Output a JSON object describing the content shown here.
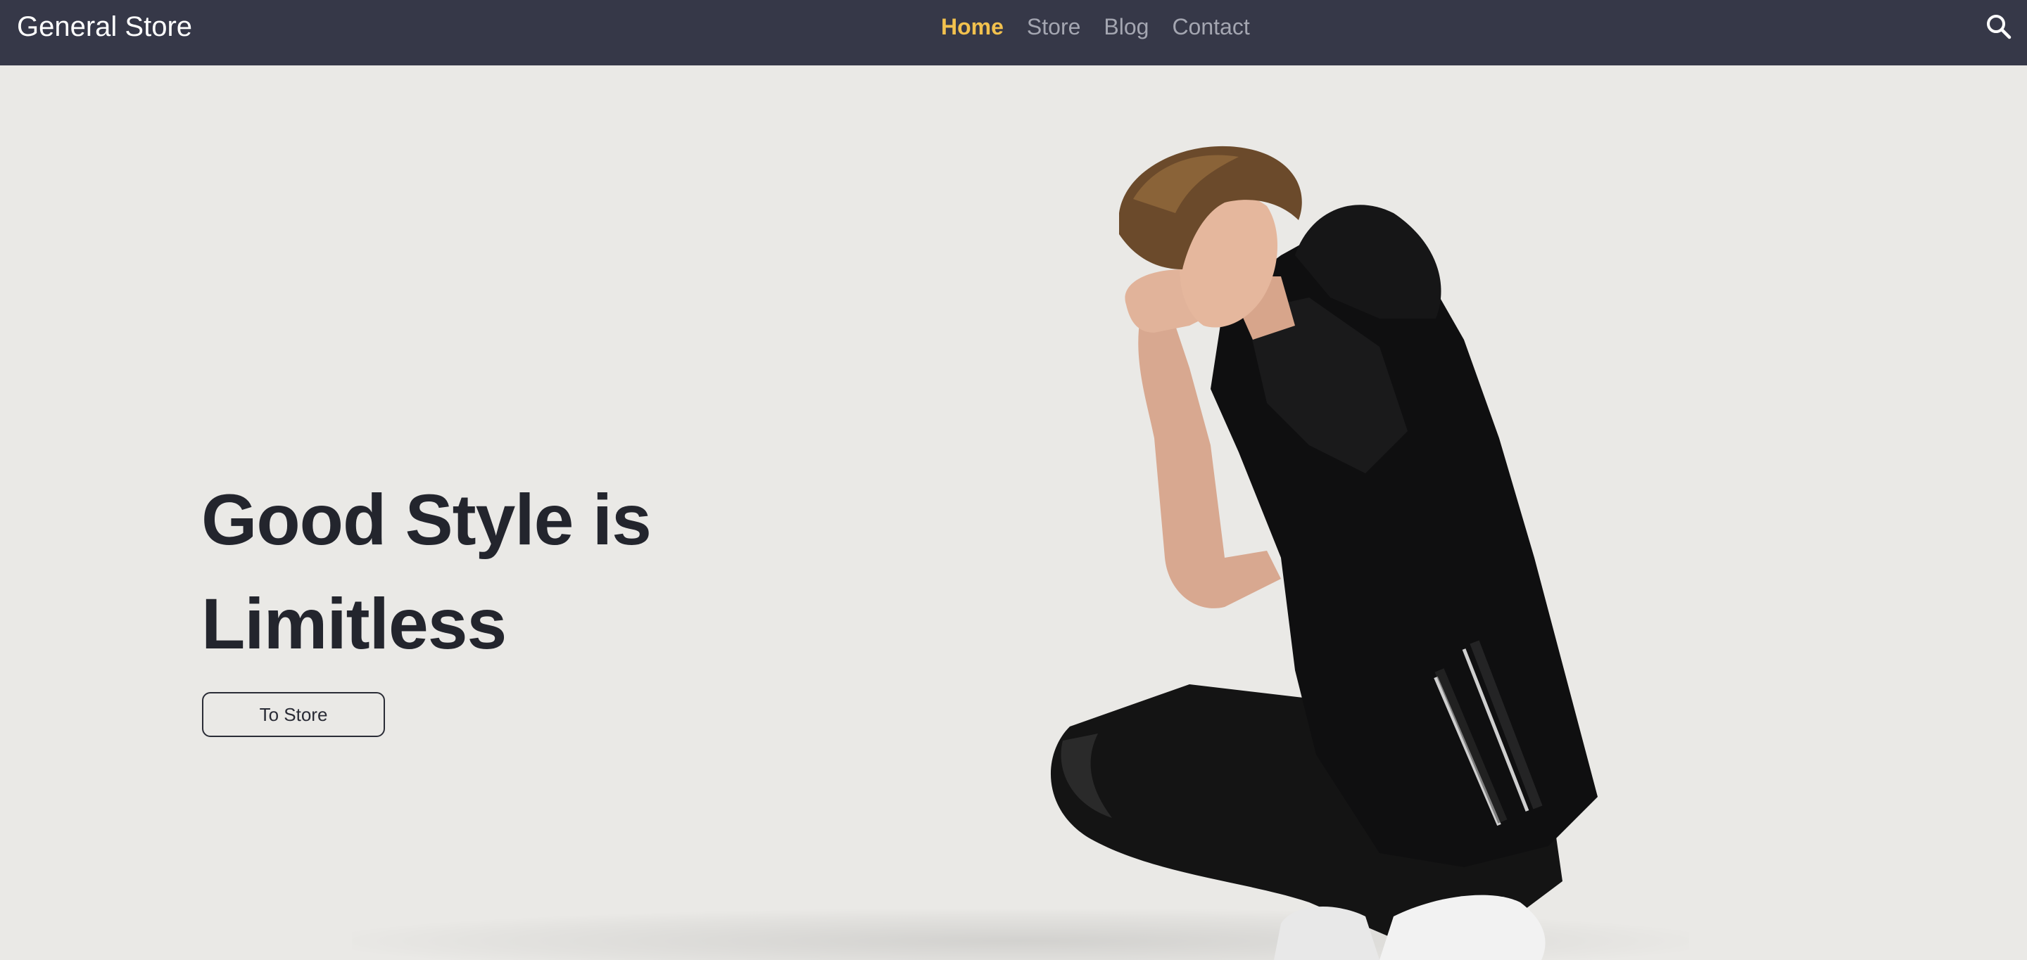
{
  "brand": {
    "name": "General Store"
  },
  "nav": {
    "items": [
      {
        "label": "Home",
        "active": true
      },
      {
        "label": "Store",
        "active": false
      },
      {
        "label": "Blog",
        "active": false
      },
      {
        "label": "Contact",
        "active": false
      }
    ],
    "search_icon": "search-icon"
  },
  "hero": {
    "headline_line1": "Good Style is",
    "headline_line2": "Limitless",
    "cta_label": "To Store",
    "image": "model-crouching-black-outfit"
  },
  "colors": {
    "navbar_bg": "#363848",
    "nav_active": "#f2c14e",
    "nav_inactive": "#a4a6b1",
    "hero_bg": "#eae9e6",
    "heading_text": "#23252d"
  }
}
